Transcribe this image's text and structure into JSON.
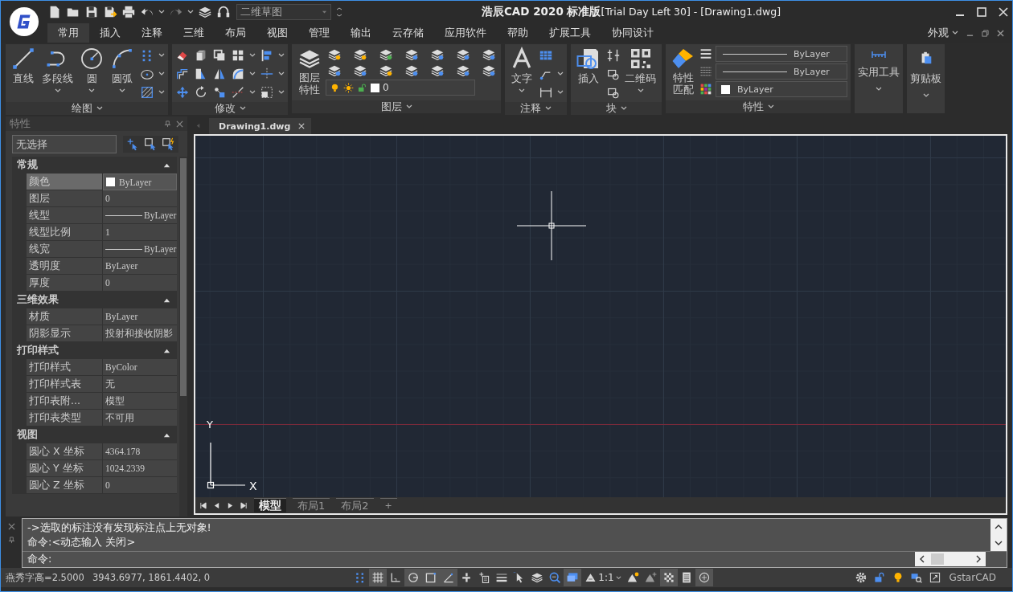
{
  "title_bar": {
    "workspace": "二维草图",
    "title": "**浩辰CAD 2020 标准版**[Trial Day Left 30] - [Drawing1.dwg]"
  },
  "menu_tabs": [
    {
      "label": "常用",
      "selected": true
    },
    {
      "label": "插入",
      "selected": false
    },
    {
      "label": "注释",
      "selected": false
    },
    {
      "label": "三维",
      "selected": false
    },
    {
      "label": "布局",
      "selected": false
    },
    {
      "label": "视图",
      "selected": false
    },
    {
      "label": "管理",
      "selected": false
    },
    {
      "label": "输出",
      "selected": false
    },
    {
      "label": "云存储",
      "selected": false
    },
    {
      "label": "应用软件",
      "selected": false
    },
    {
      "label": "帮助",
      "selected": false
    },
    {
      "label": "扩展工具",
      "selected": false
    },
    {
      "label": "协同设计",
      "selected": false
    }
  ],
  "appearance": "外观",
  "ribbon": {
    "draw": {
      "label": "绘图",
      "buttons": [
        {
          "label": "直线",
          "kind": "line",
          "dropdown": false
        },
        {
          "label": "多段线",
          "kind": "polyline",
          "dropdown": true
        },
        {
          "label": "圆",
          "kind": "circle",
          "dropdown": true
        },
        {
          "label": "圆弧",
          "kind": "arc",
          "dropdown": true
        }
      ]
    },
    "modify": {
      "label": "修改"
    },
    "layers": {
      "label": "图层",
      "button": "图层特性",
      "current_layer": "0"
    },
    "annotate": {
      "label": "注释",
      "button": "文字"
    },
    "block": {
      "label": "块",
      "insert": "插入",
      "qrcode": "二维码"
    },
    "properties": {
      "label": "特性",
      "button": "特性匹配",
      "lineweight": "ByLayer",
      "linetype": "ByLayer",
      "color_setting": "ByLayer"
    },
    "utilities": "实用工具",
    "clipboard": "剪贴板"
  },
  "properties_palette": {
    "title": "特性",
    "selection": "无选择",
    "sections": [
      {
        "title": "常规",
        "expanded": true,
        "rows": [
          {
            "label": "颜色",
            "value": "ByLayer",
            "kind": "color",
            "selected": true
          },
          {
            "label": "图层",
            "value": "0",
            "kind": "text",
            "selected": false
          },
          {
            "label": "线型",
            "value": "ByLayer",
            "kind": "line",
            "selected": false
          },
          {
            "label": "线型比例",
            "value": "1",
            "kind": "text",
            "selected": false
          },
          {
            "label": "线宽",
            "value": "ByLayer",
            "kind": "line",
            "selected": false
          },
          {
            "label": "透明度",
            "value": "ByLayer",
            "kind": "text",
            "selected": false
          },
          {
            "label": "厚度",
            "value": "0",
            "kind": "text",
            "selected": false
          }
        ]
      },
      {
        "title": "三维效果",
        "expanded": true,
        "rows": [
          {
            "label": "材质",
            "value": "ByLayer",
            "kind": "text",
            "selected": false
          },
          {
            "label": "阴影显示",
            "value": "投射和接收阴影",
            "kind": "text",
            "selected": false
          }
        ]
      },
      {
        "title": "打印样式",
        "expanded": true,
        "rows": [
          {
            "label": "打印样式",
            "value": "ByColor",
            "kind": "text",
            "selected": false
          },
          {
            "label": "打印样式表",
            "value": "无",
            "kind": "text",
            "selected": false
          },
          {
            "label": "打印表附...",
            "value": "模型",
            "kind": "text",
            "selected": false
          },
          {
            "label": "打印表类型",
            "value": "不可用",
            "kind": "text",
            "selected": false
          }
        ]
      },
      {
        "title": "视图",
        "expanded": true,
        "rows": [
          {
            "label": "圆心 X 坐标",
            "value": "4364.178",
            "kind": "text",
            "selected": false
          },
          {
            "label": "圆心 Y 坐标",
            "value": "1024.2339",
            "kind": "text",
            "selected": false
          },
          {
            "label": "圆心 Z 坐标",
            "value": "0",
            "kind": "text",
            "selected": false
          }
        ]
      }
    ]
  },
  "document_tab": "Drawing1.dwg",
  "ucs": {
    "x": "X",
    "y": "Y"
  },
  "layout_tabs": [
    {
      "label": "模型",
      "selected": true
    },
    {
      "label": "布局1",
      "selected": false
    },
    {
      "label": "布局2",
      "selected": false
    }
  ],
  "add_layout": "+",
  "command": {
    "history": [
      "->选取的标注没有发现标注点上无对象!",
      "命令:<动态输入 关闭>"
    ],
    "prompt": "命令:"
  },
  "status_bar": {
    "text_height": "燕秀字高=2.5000",
    "coordinates": "3943.6977, 1861.4402, 0",
    "scale": "1:1",
    "brand": "GstarCAD",
    "toggles_left": [
      {
        "kind": "dots",
        "on": false
      },
      {
        "kind": "grid",
        "on": true
      },
      {
        "kind": "ortho",
        "on": false
      },
      {
        "kind": "polar",
        "on": true
      },
      {
        "kind": "osnap",
        "on": true
      },
      {
        "kind": "otrack",
        "on": true
      },
      {
        "kind": "dyn",
        "on": false
      },
      {
        "kind": "textplus",
        "on": false
      },
      {
        "kind": "lineweight",
        "on": false
      },
      {
        "kind": "select",
        "on": false
      },
      {
        "kind": "layer",
        "on": false
      },
      {
        "kind": "zoom",
        "on": false
      },
      {
        "kind": "model",
        "on": true
      }
    ],
    "toggles_right": [
      {
        "kind": "annovis",
        "on": false
      },
      {
        "kind": "autoscale",
        "on": false
      },
      {
        "kind": "transparency",
        "on": true
      },
      {
        "kind": "sheet",
        "on": false
      },
      {
        "kind": "cycle",
        "on": true
      }
    ]
  }
}
